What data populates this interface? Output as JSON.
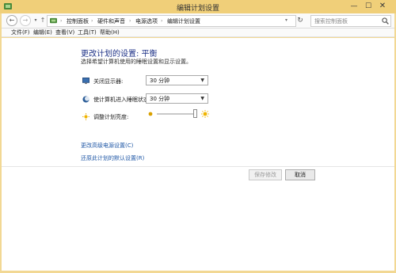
{
  "window": {
    "title": "编辑计划设置",
    "frame_color": "#f2d894"
  },
  "nav": {
    "back": "←",
    "forward": "→",
    "recent": "▾",
    "up": "↑",
    "breadcrumbs": [
      "控制面板",
      "硬件和声音",
      "电源选项",
      "编辑计划设置"
    ],
    "separator": "›",
    "search_placeholder": "搜索控制面板"
  },
  "menu": [
    {
      "label": "文件(F)"
    },
    {
      "label": "编辑(E)"
    },
    {
      "label": "查看(V)"
    },
    {
      "label": "工具(T)"
    },
    {
      "label": "帮助(H)"
    }
  ],
  "main": {
    "heading": "更改计划的设置: 平衡",
    "subtitle": "选择希望计算机使用的睡眠设置和显示设置。",
    "display_off": {
      "label": "关闭显示器:",
      "value": "30 分钟",
      "icon": "monitor-icon"
    },
    "sleep": {
      "label": "使计算机进入睡眠状态:",
      "value": "30 分钟",
      "icon": "moon-icon"
    },
    "brightness": {
      "label": "调整计划亮度:",
      "level_percent": 100,
      "icon": "sun-icon"
    },
    "links": {
      "advanced": "更改高级电源设置(C)",
      "restore": "还原此计划的默认设置(R)"
    },
    "buttons": {
      "save": "保存修改",
      "cancel": "取消"
    }
  },
  "colors": {
    "heading": "#1e3287",
    "link": "#1f57a6"
  }
}
